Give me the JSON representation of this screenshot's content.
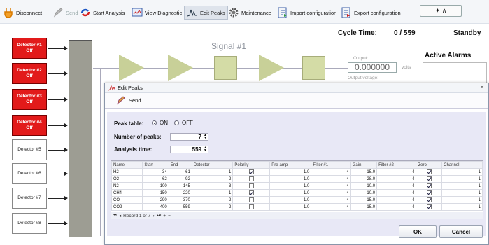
{
  "toolbar": {
    "disconnect": "Disconnect",
    "send": "Send",
    "start_analysis": "Start Analysis",
    "view_diagnostic": "View Diagnostic",
    "edit_peaks": "Edit Peaks",
    "maintenance": "Maintenance",
    "import_configuration": "Import configuration",
    "export_configuration": "Export configuration",
    "window_controls": "✦ ∧"
  },
  "status": {
    "cycle_time_label": "Cycle Time:",
    "cycle_time_value": "0 / 559",
    "state": "Standby"
  },
  "diagram": {
    "signal_title": "Signal #1",
    "output_label": "Output:",
    "output_value": "0.000000",
    "output_unit": "volts",
    "output_voltage_label": "Output voltage:",
    "active_alarms": "Active Alarms"
  },
  "detectors": [
    {
      "label": "Detector #1\nOff",
      "state": "off"
    },
    {
      "label": "Detector #2\nOff",
      "state": "off"
    },
    {
      "label": "Detector #3\nOff",
      "state": "off"
    },
    {
      "label": "Detector #4\nOff",
      "state": "off"
    },
    {
      "label": "Detector #5",
      "state": "normal"
    },
    {
      "label": "Detector #6",
      "state": "normal"
    },
    {
      "label": "Detector #7",
      "state": "normal"
    },
    {
      "label": "Detector #8",
      "state": "normal"
    }
  ],
  "dialog": {
    "title": "Edit Peaks",
    "close": "✕",
    "send": "Send",
    "peak_table_label": "Peak table:",
    "on": "ON",
    "off": "OFF",
    "peak_table_selected": "ON",
    "num_peaks_label": "Number of peaks:",
    "num_peaks_value": "7",
    "analysis_time_label": "Analysis time:",
    "analysis_time_value": "559",
    "ok": "OK",
    "cancel": "Cancel",
    "pager_text": "Record 1 of 7"
  },
  "peak_table": {
    "columns": [
      "Name",
      "Start",
      "End",
      "Detector",
      "Polarity",
      "Pre-amp",
      "Filter #1",
      "Gain",
      "Filter #2",
      "Zero",
      "Channel"
    ],
    "rows": [
      {
        "name": "H2",
        "start": "34",
        "end": "61",
        "detector": "1",
        "polarity": true,
        "preamp": "1.0",
        "filter1": "4",
        "gain": "15.0",
        "filter2": "4",
        "zero": true,
        "channel": "1"
      },
      {
        "name": "O2",
        "start": "62",
        "end": "92",
        "detector": "2",
        "polarity": false,
        "preamp": "1.0",
        "filter1": "4",
        "gain": "28.0",
        "filter2": "4",
        "zero": true,
        "channel": "1"
      },
      {
        "name": "N2",
        "start": "100",
        "end": "145",
        "detector": "3",
        "polarity": false,
        "preamp": "1.0",
        "filter1": "4",
        "gain": "10.0",
        "filter2": "4",
        "zero": true,
        "channel": "1"
      },
      {
        "name": "CH4",
        "start": "150",
        "end": "220",
        "detector": "1",
        "polarity": true,
        "preamp": "1.0",
        "filter1": "4",
        "gain": "10.0",
        "filter2": "4",
        "zero": true,
        "channel": "1"
      },
      {
        "name": "CO",
        "start": "290",
        "end": "370",
        "detector": "2",
        "polarity": false,
        "preamp": "1.0",
        "filter1": "4",
        "gain": "15.0",
        "filter2": "4",
        "zero": true,
        "channel": "1"
      },
      {
        "name": "CO2",
        "start": "400",
        "end": "559",
        "detector": "2",
        "polarity": false,
        "preamp": "1.0",
        "filter1": "4",
        "gain": "15.0",
        "filter2": "4",
        "zero": true,
        "channel": "1"
      }
    ]
  }
}
